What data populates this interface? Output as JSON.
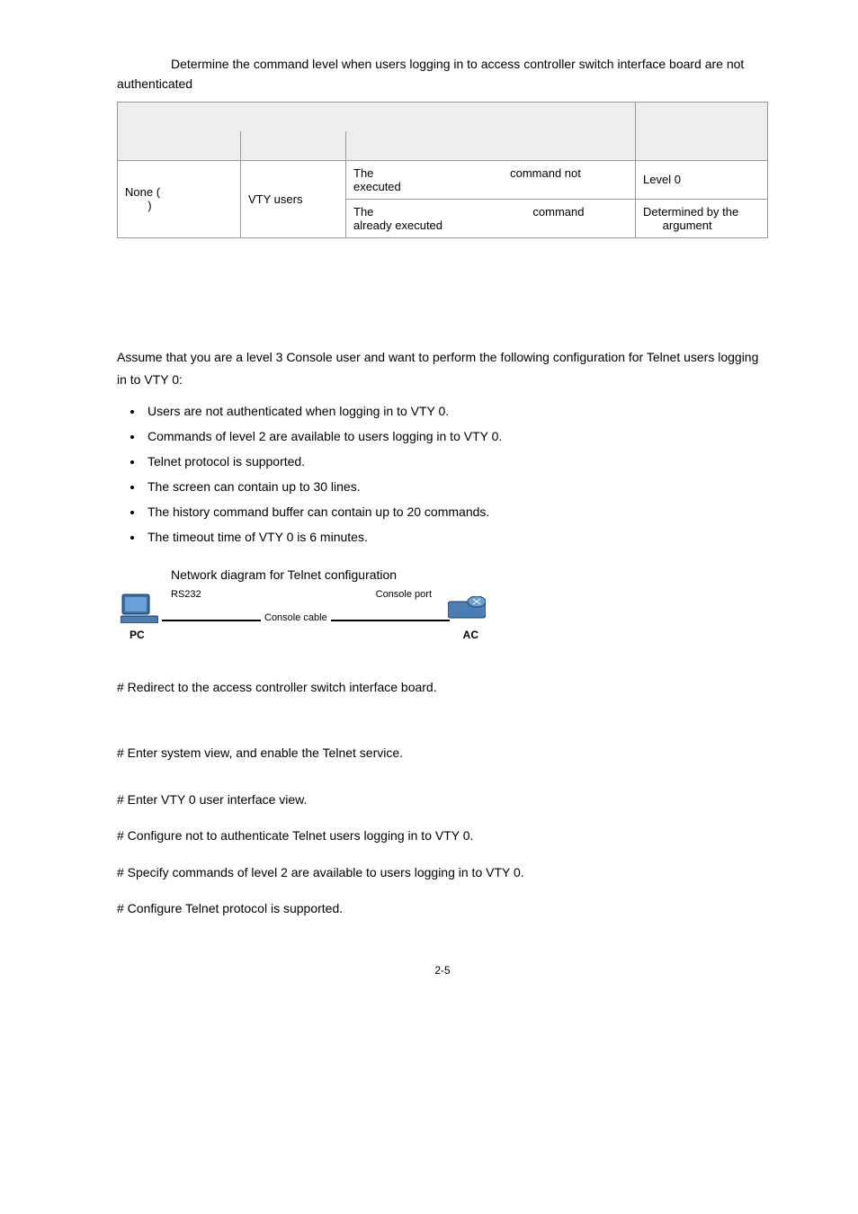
{
  "caption": "Determine the command level when users logging in to access controller switch interface board are not authenticated",
  "table": {
    "row1": {
      "auth": "None (",
      "user": "VTY users",
      "cmd1": "The",
      "cmd2": "command not executed",
      "level": "Level 0"
    },
    "row2": {
      "auth_end": ")",
      "cmd1": "The",
      "cmd2": "command already executed",
      "level": "Determined by the",
      "level2": "argument"
    }
  },
  "scenario_intro": "Assume that you are a level 3 Console user and want to perform the following configuration for Telnet users logging in to VTY 0:",
  "bullets": [
    "Users are not authenticated when logging in to VTY 0.",
    "Commands of level 2 are available to users logging in to VTY 0.",
    "Telnet protocol is supported.",
    "The screen can contain up to 30 lines.",
    "The history command buffer can contain up to 20 commands.",
    "The timeout time of VTY 0 is 6 minutes."
  ],
  "fig_caption": "Network diagram for Telnet configuration",
  "diagram": {
    "rs232": "RS232",
    "consoleport": "Console port",
    "consolecable": "Console cable",
    "pc": "PC",
    "ac": "AC"
  },
  "steps": [
    "# Redirect to the access controller switch interface board.",
    "# Enter system view, and enable the Telnet service.",
    "# Enter VTY 0 user interface view.",
    "# Configure not to authenticate Telnet users logging in to VTY 0.",
    "# Specify commands of level 2 are available to users logging in to VTY 0.",
    "# Configure Telnet protocol is supported."
  ],
  "pagenum": "2-5"
}
